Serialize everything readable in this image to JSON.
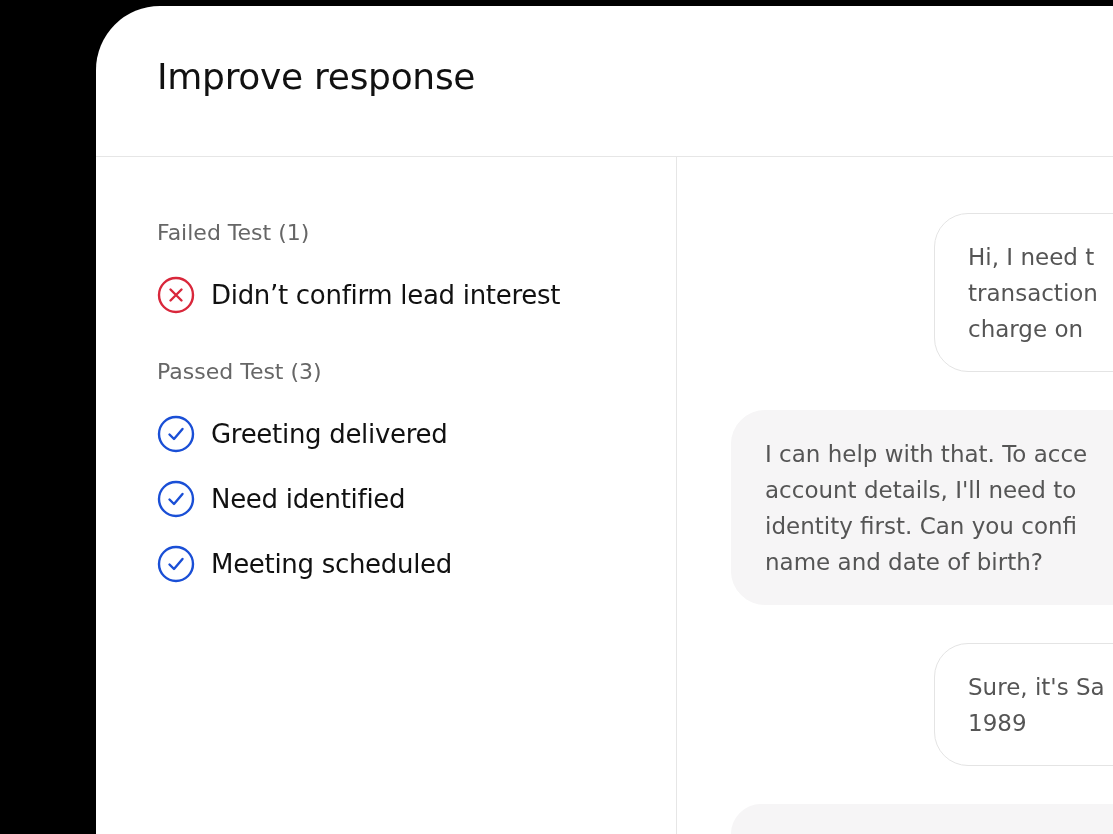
{
  "title": "Improve response",
  "test_groups": [
    {
      "heading": "Failed Test (1)",
      "tests": [
        {
          "label": "Didn’t confirm lead interest",
          "passed": false
        }
      ]
    },
    {
      "heading": "Passed Test (3)",
      "tests": [
        {
          "label": "Greeting delivered",
          "passed": true
        },
        {
          "label": "Need identified",
          "passed": true
        },
        {
          "label": "Meeting scheduled",
          "passed": true
        }
      ]
    }
  ],
  "messages": [
    {
      "kind": "user",
      "lines": [
        "Hi, I need t",
        "transaction",
        "charge on"
      ]
    },
    {
      "kind": "agent",
      "lines": [
        "I can help with that. To acce",
        "account details, I'll need to",
        "identity first. Can you confi",
        "name and date of birth?"
      ]
    },
    {
      "kind": "user",
      "lines": [
        "Sure, it's Sa",
        "1989"
      ]
    },
    {
      "kind": "agent"
    }
  ]
}
